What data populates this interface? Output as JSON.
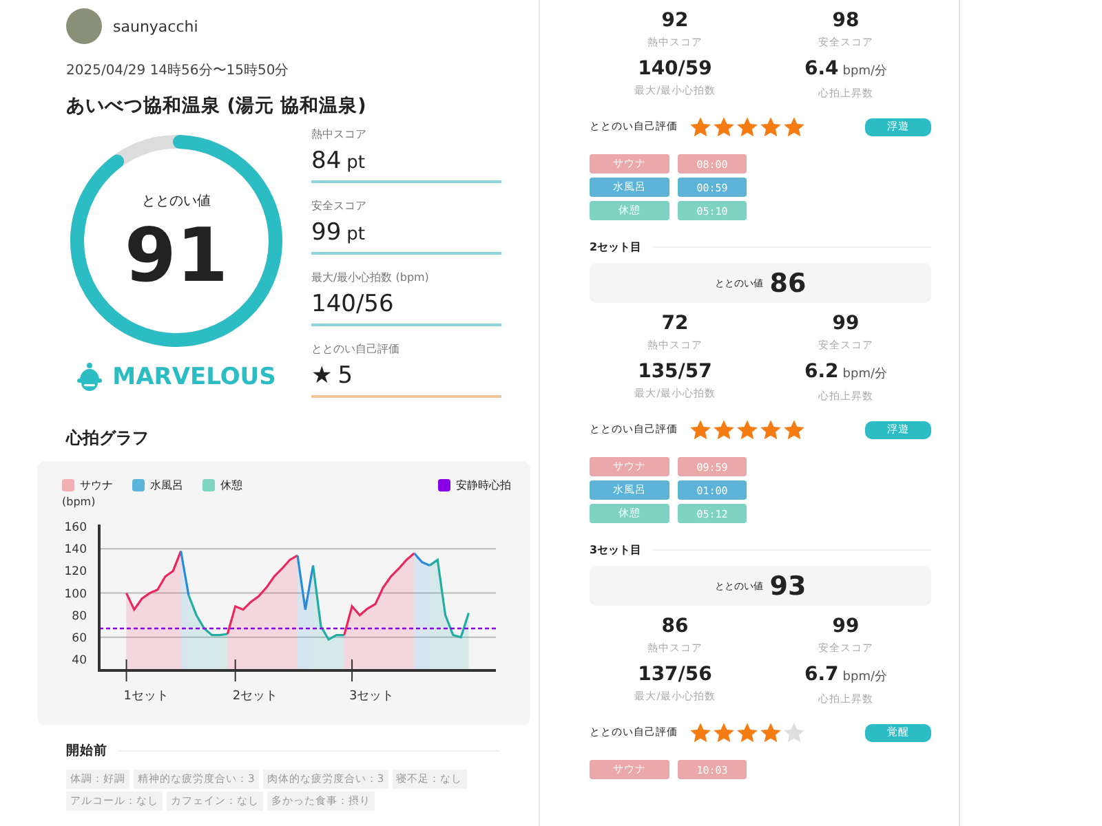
{
  "profile": {
    "username": "saunyacchi",
    "datetime": "2025/04/29 14時56分〜15時50分",
    "facility": "あいべつ協和温泉 (湯元 協和温泉)"
  },
  "gauge": {
    "label": "ととのい値",
    "value": "91",
    "level": 0.91,
    "rank": "MARVELOUS"
  },
  "stats": [
    {
      "kind": "score",
      "label": "熱中スコア",
      "value": "84",
      "unit": "pt"
    },
    {
      "kind": "score",
      "label": "安全スコア",
      "value": "99",
      "unit": "pt"
    },
    {
      "kind": "score",
      "label": "最大/最小心拍数 (bpm)",
      "value": "140/56"
    },
    {
      "kind": "rating",
      "label": "ととのい自己評価",
      "value": "5",
      "icon": "★"
    }
  ],
  "heart_graph": {
    "title": "心拍グラフ",
    "legend": [
      {
        "kind": "phase",
        "label": "サウナ",
        "color": "#f0b0b4"
      },
      {
        "kind": "phase",
        "label": "水風呂",
        "color": "#5ab4dc"
      },
      {
        "kind": "phase",
        "label": "休憩",
        "color": "#7fd4c4"
      },
      {
        "kind": "reference",
        "label": "安静時心拍",
        "color": "#8a00e6"
      }
    ],
    "y_unit": "(bpm)",
    "y_ticks": [
      "160",
      "140",
      "120",
      "100",
      "80",
      "60",
      "40"
    ],
    "x_labels": [
      "1セット",
      "2セット",
      "3セット"
    ]
  },
  "before_start": {
    "title": "開始前",
    "tags": [
      "体調：好調",
      "精神的な疲労度合い：3",
      "肉体的な疲労度合い：3",
      "寝不足：なし",
      "アルコール：なし",
      "カフェイン：なし",
      "多かった食事：摂り"
    ]
  },
  "sets": [
    {
      "metrics": [
        {
          "value": "92",
          "label": "熱中スコア"
        },
        {
          "value": "98",
          "label": "安全スコア"
        },
        {
          "value": "140/59",
          "label": "最大/最小心拍数"
        },
        {
          "value": "6.4",
          "unit": "bpm/分",
          "label": "心拍上昇数"
        }
      ],
      "rating_label": "ととのい自己評価",
      "stars": 5,
      "badge": "浮遊",
      "phases": [
        {
          "kind": "sauna",
          "name": "サウナ",
          "time": "08:00"
        },
        {
          "kind": "water",
          "name": "水風呂",
          "time": "00:59"
        },
        {
          "kind": "rest",
          "name": "休憩",
          "time": "05:10"
        }
      ]
    },
    {
      "title": "2セット目",
      "score_label": "ととのい値",
      "score": "86",
      "metrics": [
        {
          "value": "72",
          "label": "熱中スコア"
        },
        {
          "value": "99",
          "label": "安全スコア"
        },
        {
          "value": "135/57",
          "label": "最大/最小心拍数"
        },
        {
          "value": "6.2",
          "unit": "bpm/分",
          "label": "心拍上昇数"
        }
      ],
      "rating_label": "ととのい自己評価",
      "stars": 5,
      "badge": "浮遊",
      "phases": [
        {
          "kind": "sauna",
          "name": "サウナ",
          "time": "09:59"
        },
        {
          "kind": "water",
          "name": "水風呂",
          "time": "01:00"
        },
        {
          "kind": "rest",
          "name": "休憩",
          "time": "05:12"
        }
      ]
    },
    {
      "title": "3セット目",
      "score_label": "ととのい値",
      "score": "93",
      "metrics": [
        {
          "value": "86",
          "label": "熱中スコア"
        },
        {
          "value": "99",
          "label": "安全スコア"
        },
        {
          "value": "137/56",
          "label": "最大/最小心拍数"
        },
        {
          "value": "6.7",
          "unit": "bpm/分",
          "label": "心拍上昇数"
        }
      ],
      "rating_label": "ととのい自己評価",
      "stars": 4,
      "badge": "覚醒",
      "phases": [
        {
          "kind": "sauna",
          "name": "サウナ",
          "time": "10:03"
        }
      ]
    }
  ]
}
